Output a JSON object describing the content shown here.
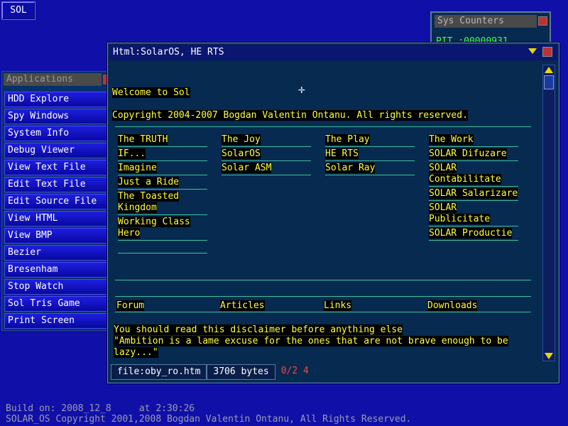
{
  "taskbar": {
    "sol_label": "SOL"
  },
  "sys_counters": {
    "title": "Sys Counters",
    "pit_label": "PIT",
    "pit_value": ":00000931"
  },
  "applications": {
    "title": "Applications",
    "items": [
      "HDD Explore",
      "Spy Windows",
      "System Info",
      "Debug Viewer",
      "View Text File",
      "Edit Text File",
      "Edit Source File",
      "View HTML",
      "View BMP",
      "Bezier",
      "Bresenham",
      "Stop Watch",
      "Sol Tris Game",
      "Print Screen"
    ]
  },
  "html_window": {
    "title": "Html:SolarOS, HE RTS",
    "welcome": "Welcome to Sol",
    "copyright": "Copyright 2004-2007 Bogdan Valentin Ontanu. All rights reserved.",
    "columns": [
      [
        "The TRUTH",
        "IF...",
        "Imagine",
        "Just a Ride",
        "The Toasted Kingdom",
        "Working Class Hero",
        ""
      ],
      [
        "The Joy",
        "SolarOS",
        "Solar ASM"
      ],
      [
        "The Play",
        "HE RTS",
        "Solar Ray"
      ],
      [
        "The Work",
        "SOLAR Difuzare",
        "SOLAR Contabilitate",
        "SOLAR Salarizare",
        "SOLAR Publicitate",
        "SOLAR Productie"
      ]
    ],
    "nav": [
      "Forum",
      "Articles",
      "Links",
      "Downloads"
    ],
    "disclaimer": "You should read this disclaimer before anything else",
    "quote_line1": "\"Ambition is a lame excuse for the ones that are not brave enough to be",
    "quote_line2": "lazy...\"",
    "status": {
      "file": "file:oby_ro.htm",
      "size": "3706 bytes",
      "pages": "0/2 4"
    }
  },
  "build_info": {
    "line1": "Build on: 2008_12_8     at 2:30:26",
    "line2": "SOLAR_OS Copyright 2001,2008 Bogdan Valentin Ontanu, All Rights Reserved."
  }
}
